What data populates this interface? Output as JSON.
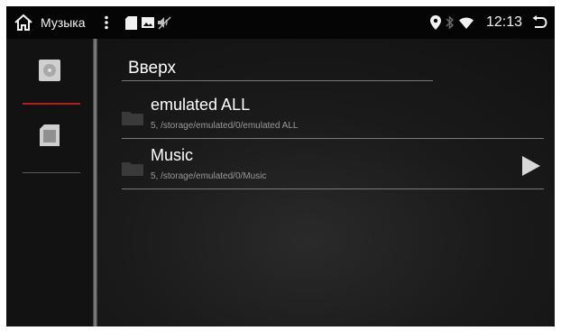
{
  "status_bar": {
    "title": "Музыка",
    "time": "12:13",
    "icons": [
      "home-icon",
      "more-vert-icon",
      "sd-card-icon",
      "image-icon",
      "mute-icon",
      "location-icon",
      "bluetooth-icon",
      "wifi-icon",
      "back-icon"
    ]
  },
  "sidebar": {
    "items": [
      {
        "icon": "disk-icon",
        "active": true
      },
      {
        "icon": "sd-card-icon",
        "active": false
      }
    ]
  },
  "list": {
    "up_label": "Вверх",
    "items": [
      {
        "name": "emulated ALL",
        "path": "5, /storage/emulated/0/emulated ALL",
        "icon": "folder-icon",
        "playable": false
      },
      {
        "name": "Music",
        "path": "5, /storage/emulated/0/Music",
        "icon": "folder-icon",
        "playable": true
      }
    ]
  },
  "colors": {
    "accent": "#b01e1e",
    "background": "#141414",
    "status_bar": "#050505"
  }
}
